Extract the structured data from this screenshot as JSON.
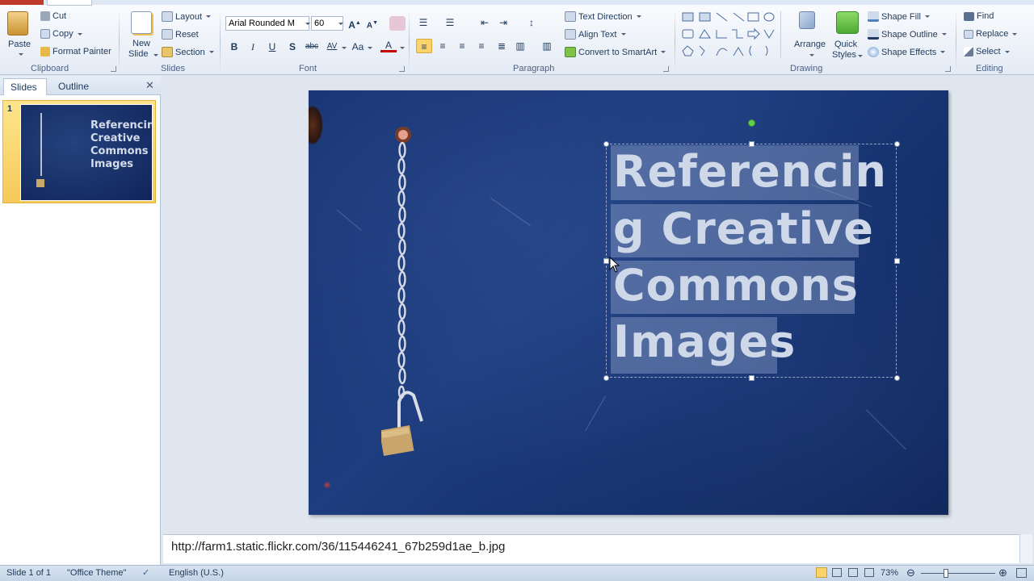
{
  "ribbon": {
    "clipboard": {
      "label": "Clipboard",
      "paste": "Paste",
      "cut": "Cut",
      "copy": "Copy",
      "format_painter": "Format Painter"
    },
    "slides": {
      "label": "Slides",
      "new_slide_1": "New",
      "new_slide_2": "Slide",
      "layout": "Layout",
      "reset": "Reset",
      "section": "Section"
    },
    "font": {
      "label": "Font",
      "family": "Arial Rounded M",
      "size": "60",
      "bold": "B",
      "italic": "I",
      "underline": "U",
      "strike": "S",
      "abc": "abc",
      "av": "AV",
      "aa": "Aa",
      "a": "A"
    },
    "paragraph": {
      "label": "Paragraph",
      "text_direction": "Text Direction",
      "align_text": "Align Text",
      "convert_smartart": "Convert to SmartArt"
    },
    "drawing": {
      "label": "Drawing",
      "arrange": "Arrange",
      "quick_styles_1": "Quick",
      "quick_styles_2": "Styles",
      "shape_fill": "Shape Fill",
      "shape_outline": "Shape Outline",
      "shape_effects": "Shape Effects"
    },
    "editing": {
      "label": "Editing",
      "find": "Find",
      "replace": "Replace",
      "select": "Select"
    }
  },
  "left_pane": {
    "tab_slides": "Slides",
    "tab_outline": "Outline",
    "close": "✕",
    "slide_number": "1",
    "thumb_title": "Referencing Creative Commons Images"
  },
  "slide": {
    "title_lines": [
      "Referencin",
      "g Creative",
      "Commons",
      "Images"
    ]
  },
  "notes": {
    "text": "http://farm1.static.flickr.com/36/115446241_67b259d1ae_b.jpg"
  },
  "status": {
    "slide": "Slide 1 of 1",
    "theme": "\"Office Theme\"",
    "language": "English (U.S.)",
    "zoom": "73%"
  },
  "colors": {
    "accent": "#f7c95a",
    "slide_bg": "#1a3673"
  }
}
